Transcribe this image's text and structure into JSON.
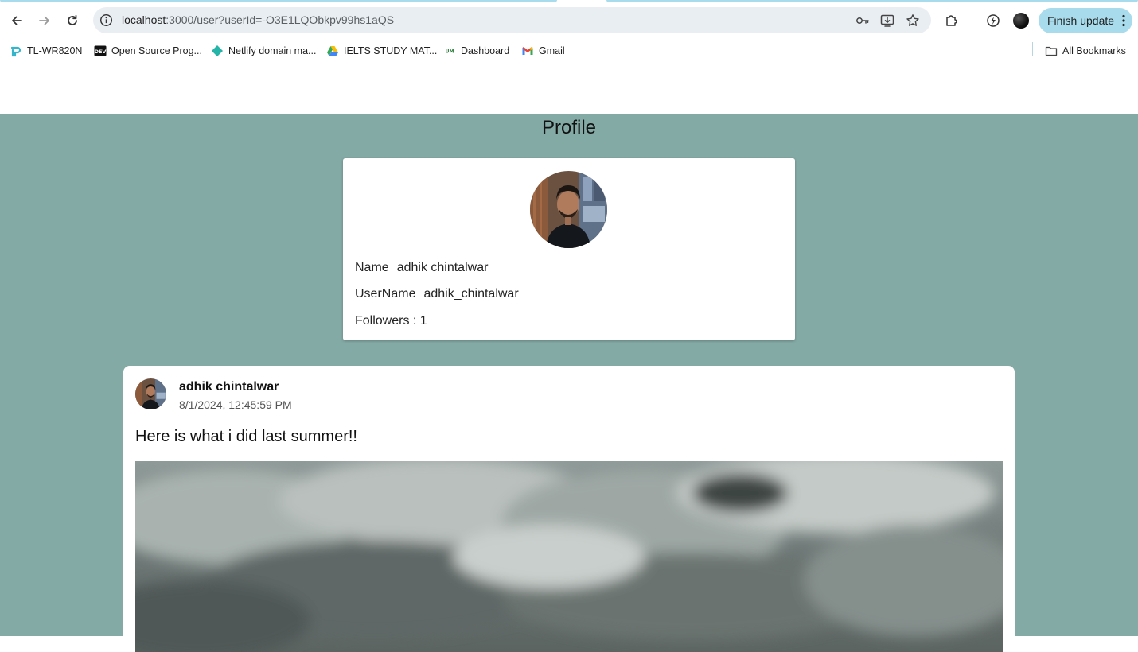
{
  "browser": {
    "url_host": "localhost",
    "url_path": ":3000/user?userId=-O3E1LQObkpv99hs1aQS",
    "finish_update_label": "Finish update"
  },
  "bookmarks": [
    {
      "label": "TL-WR820N",
      "icon": "tplink-icon"
    },
    {
      "label": "Open Source Prog...",
      "icon": "dev-icon"
    },
    {
      "label": "Netlify domain ma...",
      "icon": "netlify-icon"
    },
    {
      "label": "IELTS STUDY MAT...",
      "icon": "drive-icon"
    },
    {
      "label": "Dashboard",
      "icon": "dashboard-icon"
    },
    {
      "label": "Gmail",
      "icon": "gmail-icon"
    }
  ],
  "all_bookmarks_label": "All Bookmarks",
  "page": {
    "title": "Profile",
    "profile": {
      "name_label": "Name",
      "name_value": "adhik chintalwar",
      "username_label": "UserName",
      "username_value": "adhik_chintalwar",
      "followers_text": "Followers : 1"
    },
    "post": {
      "author": "adhik chintalwar",
      "timestamp": "8/1/2024, 12:45:59 PM",
      "text": "Here is what i did last summer!!"
    }
  },
  "colors": {
    "page_background": "#84aaa6",
    "update_button": "#a8dcec"
  }
}
